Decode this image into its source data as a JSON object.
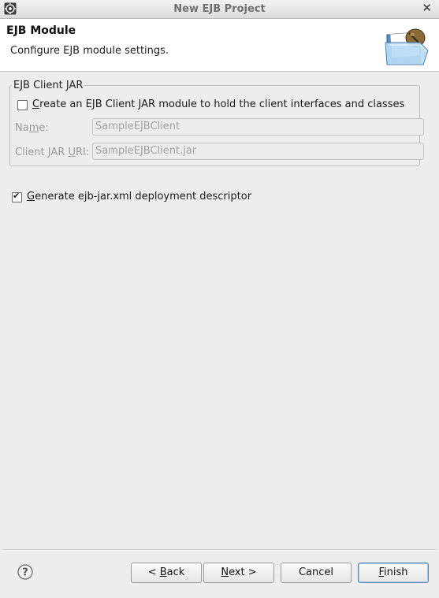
{
  "window": {
    "title": "New EJB Project",
    "close_glyph": "✕"
  },
  "header": {
    "title": "EJB Module",
    "description": "Configure EJB module settings.",
    "icon": "folder-with-bean-icon"
  },
  "client_jar": {
    "legend": "EJB Client JAR",
    "create_checkbox": {
      "checked": false,
      "mnemonic": "C",
      "label_rest": "reate an EJB Client JAR module to hold the client interfaces and classes"
    },
    "name": {
      "label_pre": "Na",
      "mnemonic": "m",
      "label_post": "e:",
      "value": "SampleEJBClient"
    },
    "uri": {
      "label_pre": "Client JAR ",
      "mnemonic": "U",
      "label_post": "RI:",
      "value": "SampleEJBClient.jar"
    }
  },
  "generate_descriptor": {
    "checked": true,
    "mnemonic": "G",
    "label_rest": "enerate ejb-jar.xml deployment descriptor"
  },
  "buttons": {
    "help_icon": "help-icon",
    "back": {
      "pre": "< ",
      "mnemonic": "B",
      "post": "ack"
    },
    "next": {
      "pre": "",
      "mnemonic": "N",
      "post": "ext >"
    },
    "cancel": {
      "label": "Cancel"
    },
    "finish": {
      "pre": "",
      "mnemonic": "F",
      "post": "inish"
    }
  }
}
